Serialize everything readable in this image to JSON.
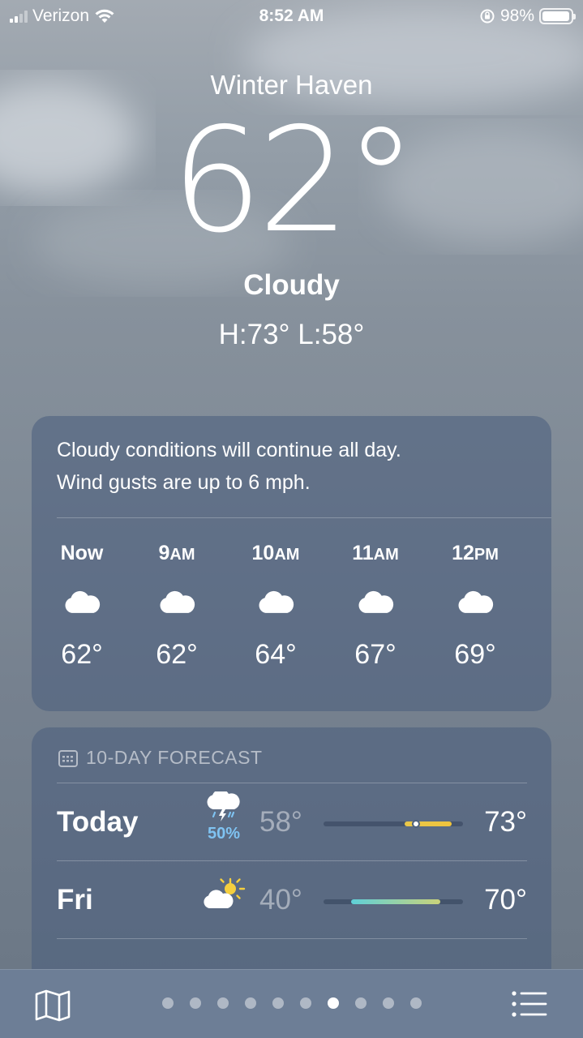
{
  "status_bar": {
    "carrier": "Verizon",
    "time": "8:52 AM",
    "battery": "98%",
    "battery_level": 0.98
  },
  "current": {
    "city": "Winter Haven",
    "temperature": "62°",
    "condition": "Cloudy",
    "high_low": "H:73°  L:58°"
  },
  "hourly": {
    "summary_line1": "Cloudy conditions will continue all day.",
    "summary_line2": "Wind gusts are up to 6 mph.",
    "items": [
      {
        "time": "Now",
        "icon": "cloud-icon",
        "temp": "62°"
      },
      {
        "time": "9",
        "suffix": "AM",
        "icon": "cloud-icon",
        "temp": "62°"
      },
      {
        "time": "10",
        "suffix": "AM",
        "icon": "cloud-icon",
        "temp": "64°"
      },
      {
        "time": "11",
        "suffix": "AM",
        "icon": "cloud-icon",
        "temp": "67°"
      },
      {
        "time": "12",
        "suffix": "PM",
        "icon": "cloud-icon",
        "temp": "69°"
      }
    ]
  },
  "forecast": {
    "header": "10-DAY FORECAST",
    "days": [
      {
        "day": "Today",
        "icon": "cloud-bolt-rain-icon",
        "precip": "50%",
        "low": "58°",
        "high": "73°",
        "bar_start": 0.58,
        "bar_end": 0.92,
        "current_marker": 0.66,
        "colors": [
          "#e9c74a",
          "#f0c43c"
        ]
      },
      {
        "day": "Fri",
        "icon": "partly-sunny-icon",
        "precip": "",
        "low": "40°",
        "high": "70°",
        "bar_start": 0.2,
        "bar_end": 0.84,
        "colors": [
          "#5fd0d8",
          "#c9d27a"
        ]
      }
    ]
  },
  "toolbar": {
    "map_icon": "map-icon",
    "list_icon": "list-icon",
    "page_count": 10,
    "active_page": 7
  },
  "colors": {
    "precip": "#7fc3f2",
    "card_bg": "rgba(75,95,125,0.58)"
  }
}
